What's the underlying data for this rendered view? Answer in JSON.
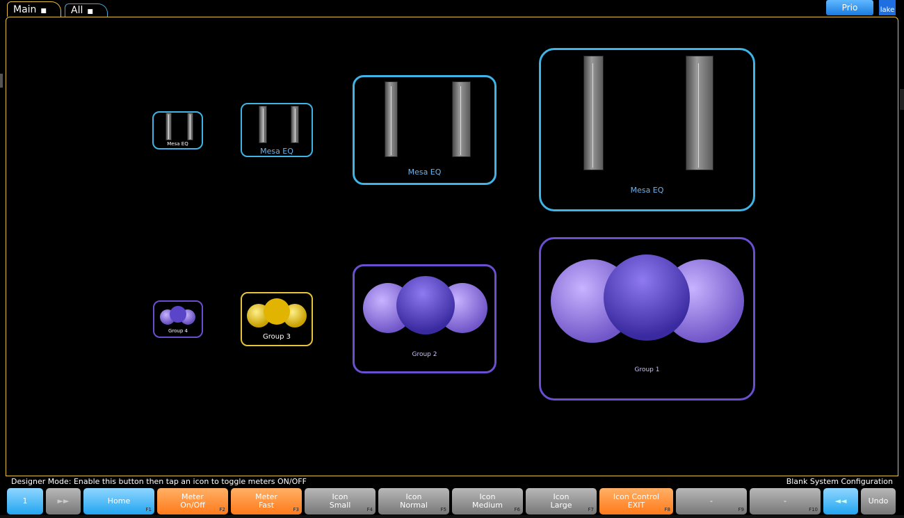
{
  "tabs": [
    {
      "label": "Main"
    },
    {
      "label": "All"
    }
  ],
  "header": {
    "prio_label": "Prio",
    "logo_text": "lake"
  },
  "tiles": {
    "mesa_small": {
      "label": "Mesa EQ"
    },
    "mesa_medium": {
      "label": "Mesa EQ"
    },
    "mesa_large": {
      "label": "Mesa EQ"
    },
    "mesa_xlarge": {
      "label": "Mesa EQ"
    },
    "group4": {
      "label": "Group 4"
    },
    "group3": {
      "label": "Group 3"
    },
    "group2": {
      "label": "Group 2"
    },
    "group1": {
      "label": "Group 1"
    }
  },
  "status": {
    "message": "Designer Mode:  Enable this button then tap an icon to toggle meters ON/OFF",
    "config": "Blank System Configuration"
  },
  "keys": [
    {
      "label": "1",
      "fkey": ""
    },
    {
      "label": "►►",
      "fkey": ""
    },
    {
      "label": "Home",
      "fkey": "F1"
    },
    {
      "label": "Meter\nOn/Off",
      "fkey": "F2"
    },
    {
      "label": "Meter\nFast",
      "fkey": "F3"
    },
    {
      "label": "Icon\nSmall",
      "fkey": "F4"
    },
    {
      "label": "Icon\nNormal",
      "fkey": "F5"
    },
    {
      "label": "Icon\nMedium",
      "fkey": "F6"
    },
    {
      "label": "Icon\nLarge",
      "fkey": "F7"
    },
    {
      "label": "Icon Control\nEXIT",
      "fkey": "F8"
    },
    {
      "label": "-",
      "fkey": "F9"
    },
    {
      "label": "-",
      "fkey": "F10"
    },
    {
      "label": "◄◄",
      "fkey": ""
    },
    {
      "label": "Undo",
      "fkey": ""
    }
  ],
  "colors": {
    "accent_yellow": "#e8c43a",
    "cyan": "#3fb4e6",
    "purple": "#6a4fd0",
    "orange": "#ff7a1a",
    "blue": "#22a5f0"
  }
}
